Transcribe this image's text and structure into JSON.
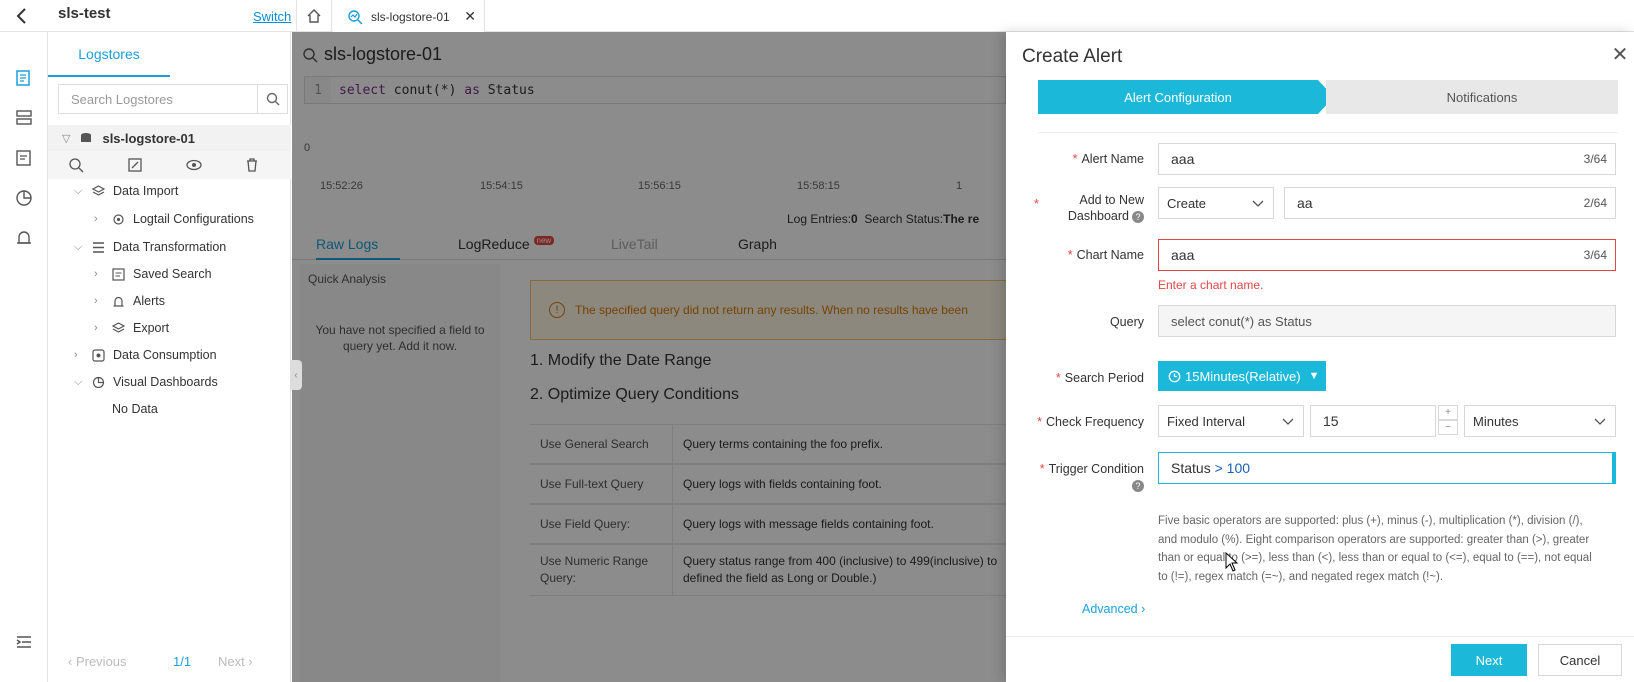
{
  "topbar": {
    "project_name": "sls-test",
    "switch_label": "Switch",
    "tab_label": "sls-logstore-01"
  },
  "sidebar": {
    "tab_label": "Logstores",
    "search_placeholder": "Search Logstores",
    "logstore_name": "sls-logstore-01",
    "tree": {
      "data_import": "Data Import",
      "logtail_configurations": "Logtail Configurations",
      "data_transformation": "Data Transformation",
      "saved_search": "Saved Search",
      "alerts": "Alerts",
      "export": "Export",
      "data_consumption": "Data Consumption",
      "visual_dashboards": "Visual Dashboards",
      "no_data": "No Data"
    },
    "pager": {
      "previous": "Previous",
      "page": "1/1",
      "next": "Next"
    }
  },
  "main": {
    "title": "sls-logstore-01",
    "query_line_number": "1",
    "query": {
      "select": "select",
      "func": "conut(*)",
      "as": "as",
      "alias": "Status"
    },
    "histogram": {
      "y_zero": "0",
      "ticks": [
        "15:52:26",
        "15:54:15",
        "15:56:15",
        "15:58:15",
        "1"
      ]
    },
    "log_entries_label": "Log Entries:",
    "log_entries_value": "0",
    "search_status_label": "Search Status:",
    "search_status_value": "The re",
    "tabs": {
      "raw_logs": "Raw Logs",
      "logreduce": "LogReduce",
      "new_badge": "new",
      "livetail": "LiveTail",
      "graph": "Graph"
    },
    "quick_analysis": "Quick Analysis",
    "quick_analysis_empty": "You have not specified a field to query yet. Add it now.",
    "warning": "The specified query did not return any results. When no results have been",
    "help_1": "1. Modify the Date Range",
    "help_2": "2. Optimize Query Conditions",
    "help_rows": [
      {
        "a": "Use General Search",
        "b": "Query terms containing the foo prefix."
      },
      {
        "a": "Use Full-text Query",
        "b": "Query logs with fields containing foot."
      },
      {
        "a": "Use Field Query:",
        "b": "Query logs with message fields containing foot."
      },
      {
        "a": "Use Numeric Range Query:",
        "b": "Query status range from 400 (inclusive) to 499(inclusive) to defined the field as Long or Double.)"
      }
    ]
  },
  "drawer": {
    "title": "Create Alert",
    "step1": "Alert Configuration",
    "step2": "Notifications",
    "alert_name_label": "Alert Name",
    "alert_name_value": "aaa",
    "alert_name_count": "3/64",
    "dashboard_label": "Add to New Dashboard",
    "dashboard_mode": "Create",
    "dashboard_value": "aa",
    "dashboard_count": "2/64",
    "chart_name_label": "Chart Name",
    "chart_name_value": "aaa",
    "chart_name_count": "3/64",
    "chart_name_error": "Enter a chart name.",
    "query_label": "Query",
    "query_value": "select conut(*) as Status",
    "search_period_label": "Search Period",
    "search_period_value": "15Minutes(Relative)",
    "check_frequency_label": "Check Frequency",
    "check_frequency_mode": "Fixed Interval",
    "check_frequency_value": "15",
    "check_frequency_unit": "Minutes",
    "trigger_label": "Trigger Condition",
    "trigger_field": "Status",
    "trigger_op": ">",
    "trigger_num": "100",
    "operator_help": "Five basic operators are supported: plus (+), minus (-), multiplication (*), division (/), and modulo (%). Eight comparison operators are supported: greater than (>), greater than or equal to (>=), less than (<), less than or equal to (<=), equal to (==), not equal to (!=), regex match (=~), and negated regex match (!~).",
    "advanced": "Advanced",
    "next": "Next",
    "cancel": "Cancel"
  },
  "colors": {
    "accent": "#1bb8d9",
    "link": "#1a9fdb",
    "error": "#e64545",
    "warning": "#d87a00"
  }
}
